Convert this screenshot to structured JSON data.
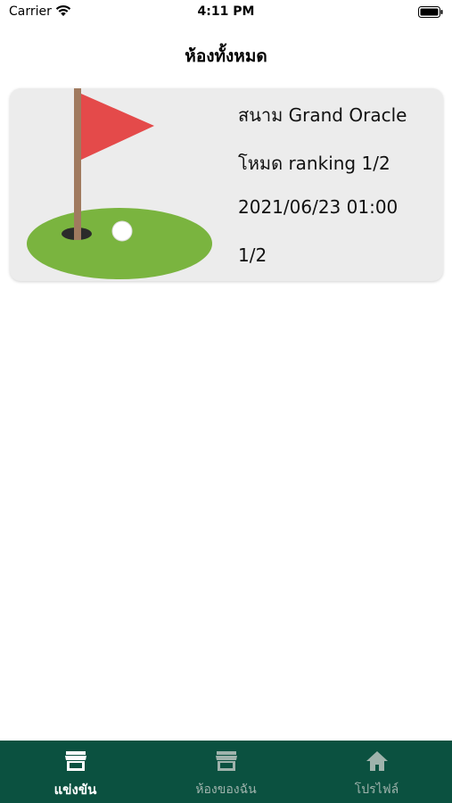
{
  "status_bar": {
    "carrier": "Carrier",
    "time": "4:11 PM"
  },
  "header": {
    "title": "ห้องทั้งหมด"
  },
  "rooms": [
    {
      "course": "สนาม Grand Oracle",
      "mode": "โหมด ranking 1/2",
      "datetime": "2021/06/23 01:00",
      "players": "1/2",
      "image_icon": "golf-flag-hole-icon"
    }
  ],
  "tab_bar": {
    "tabs": [
      {
        "label": "แข่งขัน",
        "icon": "store-icon",
        "active": true
      },
      {
        "label": "ห้องของฉัน",
        "icon": "store-icon",
        "active": false
      },
      {
        "label": "โปรไฟล์",
        "icon": "home-icon",
        "active": false
      }
    ]
  },
  "colors": {
    "tab_bar_bg": "#0b5140",
    "tab_active": "#ffffff",
    "tab_inactive": "#9fb3ac",
    "card_bg": "#ececec",
    "green": "#7ab43f",
    "flag_red": "#e44a4a",
    "pole_brown": "#a07a5f"
  }
}
